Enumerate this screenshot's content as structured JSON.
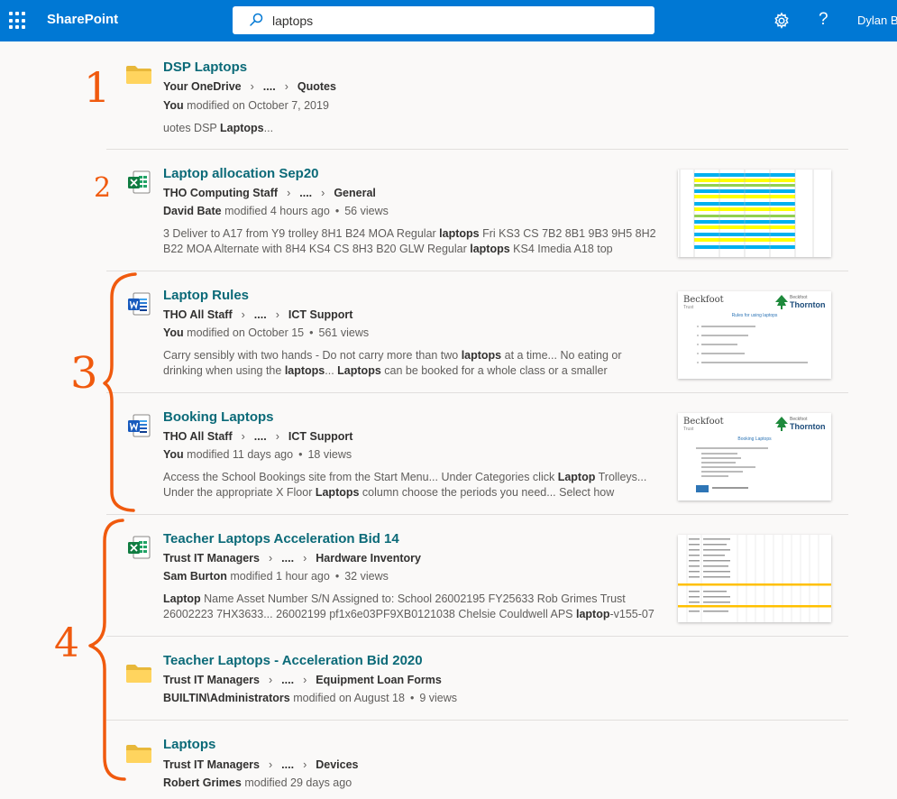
{
  "suite_bar": {
    "brand": "SharePoint",
    "search_value": "laptops",
    "user_name": "Dylan B",
    "help_label": "?",
    "color": "#0078d4"
  },
  "results": [
    {
      "icon": "folder-icon",
      "title": "DSP Laptops",
      "crumb": [
        "Your OneDrive",
        "....",
        "Quotes"
      ],
      "meta": {
        "who": "You",
        "action": "modified on October 7, 2019",
        "views": ""
      },
      "snippet_parts": [
        [
          "uotes DSP ",
          false
        ],
        [
          "Laptops",
          true
        ],
        [
          "...",
          false
        ]
      ]
    },
    {
      "icon": "excel-icon",
      "title": "Laptop allocation Sep20",
      "crumb": [
        "THO Computing Staff",
        "....",
        "General"
      ],
      "meta": {
        "who": "David Bate",
        "action": "modified 4 hours ago",
        "views": "56 views"
      },
      "snippet_parts": [
        [
          "3 Deliver to A17 from Y9 trolley 8H1 B24 MOA Regular ",
          false
        ],
        [
          "laptops",
          true
        ],
        [
          " Fri KS3 CS 7B2 8B1 9B3 9H5 8H2 B22 MOA Alternate with 8H4 KS4 CS 8H3 B20 GLW Regular ",
          false
        ],
        [
          "laptops",
          true
        ],
        [
          " KS4 Imedia A18 top",
          false
        ]
      ]
    },
    {
      "icon": "word-icon",
      "title": "Laptop Rules",
      "crumb": [
        "THO All Staff",
        "....",
        "ICT Support"
      ],
      "meta": {
        "who": "You",
        "action": "modified on October 15",
        "views": "561 views"
      },
      "snippet_parts": [
        [
          "Carry sensibly with two hands - Do not carry more than two ",
          false
        ],
        [
          "laptops",
          true
        ],
        [
          " at a time... No eating or drinking when using the ",
          false
        ],
        [
          "laptops",
          true
        ],
        [
          "... ",
          false
        ],
        [
          "Laptops",
          true
        ],
        [
          " can be booked for a whole class or a smaller",
          false
        ]
      ],
      "thumb": {
        "brand_left": "Beckfoot",
        "brand_sub": "Trust",
        "brand_right_top": "Beckfoot",
        "brand_right": "Thornton",
        "heading": "Rules for using laptops"
      }
    },
    {
      "icon": "word-icon",
      "title": "Booking Laptops",
      "crumb": [
        "THO All Staff",
        "....",
        "ICT Support"
      ],
      "meta": {
        "who": "You",
        "action": "modified 11 days ago",
        "views": "18 views"
      },
      "snippet_parts": [
        [
          "Access the School Bookings site from the Start Menu... Under Categories click ",
          false
        ],
        [
          "Laptop",
          true
        ],
        [
          " Trolleys... Under the appropriate X Floor ",
          false
        ],
        [
          "Laptops",
          true
        ],
        [
          " column choose the periods you need... Select how",
          false
        ]
      ],
      "thumb": {
        "brand_left": "Beckfoot",
        "brand_sub": "Trust",
        "brand_right_top": "Beckfoot",
        "brand_right": "Thornton",
        "heading": "Booking Laptops"
      }
    },
    {
      "icon": "excel-icon",
      "title": "Teacher Laptops Acceleration Bid 14",
      "crumb": [
        "Trust IT Managers",
        "....",
        "Hardware Inventory"
      ],
      "meta": {
        "who": "Sam Burton",
        "action": "modified 1 hour ago",
        "views": "32 views"
      },
      "snippet_parts": [
        [
          "Laptop",
          true
        ],
        [
          " Name Asset Number S/N Assigned to: School 26002195 FY25633 Rob Grimes Trust 26002223 7HX3633... 26002199 pf1x6e03PF9XB0121038 Chelsie Couldwell APS ",
          false
        ],
        [
          "laptop",
          true
        ],
        [
          "-v155-07",
          false
        ]
      ]
    },
    {
      "icon": "folder-icon",
      "title": "Teacher Laptops - Acceleration Bid 2020",
      "crumb": [
        "Trust IT Managers",
        "....",
        "Equipment Loan Forms"
      ],
      "meta": {
        "who": "BUILTIN\\Administrators",
        "action": "modified on August 18",
        "views": "9 views"
      },
      "snippet_parts": []
    },
    {
      "icon": "folder-icon",
      "title": "Laptops",
      "crumb": [
        "Trust IT Managers",
        "....",
        "Devices"
      ],
      "meta": {
        "who": "Robert Grimes",
        "action": "modified 29 days ago",
        "views": ""
      },
      "snippet_parts": []
    }
  ],
  "annotations": [
    "1",
    "2",
    "3",
    "4"
  ],
  "annotation_color": "#f05a0e"
}
